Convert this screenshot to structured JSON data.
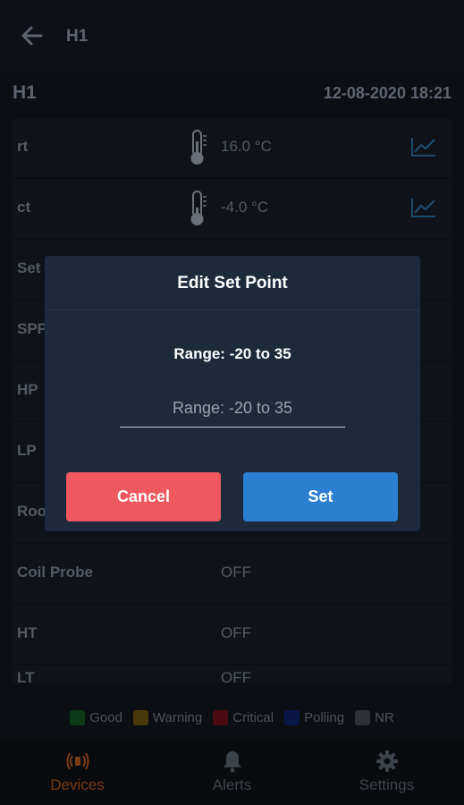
{
  "appbar": {
    "title": "H1"
  },
  "header": {
    "device_name": "H1",
    "timestamp": "12-08-2020 18:21"
  },
  "rows": [
    {
      "label": "rt",
      "value": "16.0 °C",
      "icon": "thermometer-icon",
      "trend": true
    },
    {
      "label": "ct",
      "value": "-4.0 °C",
      "icon": "thermometer-icon",
      "trend": true
    },
    {
      "label": "Set",
      "value": "",
      "icon": "",
      "trend": false
    },
    {
      "label": "SPP",
      "value": "",
      "icon": "",
      "trend": false
    },
    {
      "label": "HP",
      "value": "",
      "icon": "",
      "trend": false
    },
    {
      "label": "LP",
      "value": "",
      "icon": "",
      "trend": false
    },
    {
      "label": "Roo",
      "value": "",
      "icon": "",
      "trend": false
    },
    {
      "label": "Coil Probe",
      "value": "OFF",
      "icon": "",
      "trend": false
    },
    {
      "label": "HT",
      "value": "OFF",
      "icon": "",
      "trend": false
    },
    {
      "label": "LT",
      "value": "OFF",
      "icon": "",
      "trend": false
    }
  ],
  "legend": [
    {
      "label": "Good",
      "color": "#0c3a16"
    },
    {
      "label": "Warning",
      "color": "#4a3a0a"
    },
    {
      "label": "Critical",
      "color": "#4a0c12"
    },
    {
      "label": "Polling",
      "color": "#0b1648"
    },
    {
      "label": "NR",
      "color": "#2e3238"
    }
  ],
  "nav": [
    {
      "label": "Devices",
      "icon": "devices-icon",
      "active": true
    },
    {
      "label": "Alerts",
      "icon": "bell-icon",
      "active": false
    },
    {
      "label": "Settings",
      "icon": "gear-icon",
      "active": false
    }
  ],
  "dialog": {
    "title": "Edit Set Point",
    "range_label": "Range: -20 to 35",
    "input_placeholder": "Range: -20 to 35",
    "input_value": "",
    "cancel_label": "Cancel",
    "set_label": "Set"
  },
  "colors": {
    "dialog_bg": "#1d2a3c",
    "cancel": "#f0585f",
    "set": "#2b7fd0",
    "active_nav": "#7a3a12"
  }
}
